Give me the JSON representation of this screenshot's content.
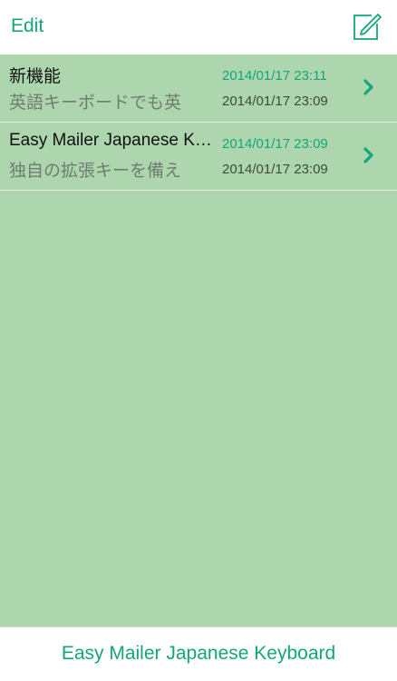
{
  "navbar": {
    "edit_label": "Edit",
    "compose_icon": "compose-icon"
  },
  "notes": [
    {
      "title": "新機能",
      "preview": "英語キーボードでも英",
      "modified": "2014/01/17 23:11",
      "created": "2014/01/17 23:09"
    },
    {
      "title": "Easy Mailer Japanese Keyboard",
      "preview": "独自の拡張キーを備え",
      "modified": "2014/01/17 23:09",
      "created": "2014/01/17 23:09"
    }
  ],
  "bottombar": {
    "title": "Easy Mailer Japanese Keyboard"
  },
  "colors": {
    "accent": "#12a67a",
    "list_background": "#add6ae"
  }
}
